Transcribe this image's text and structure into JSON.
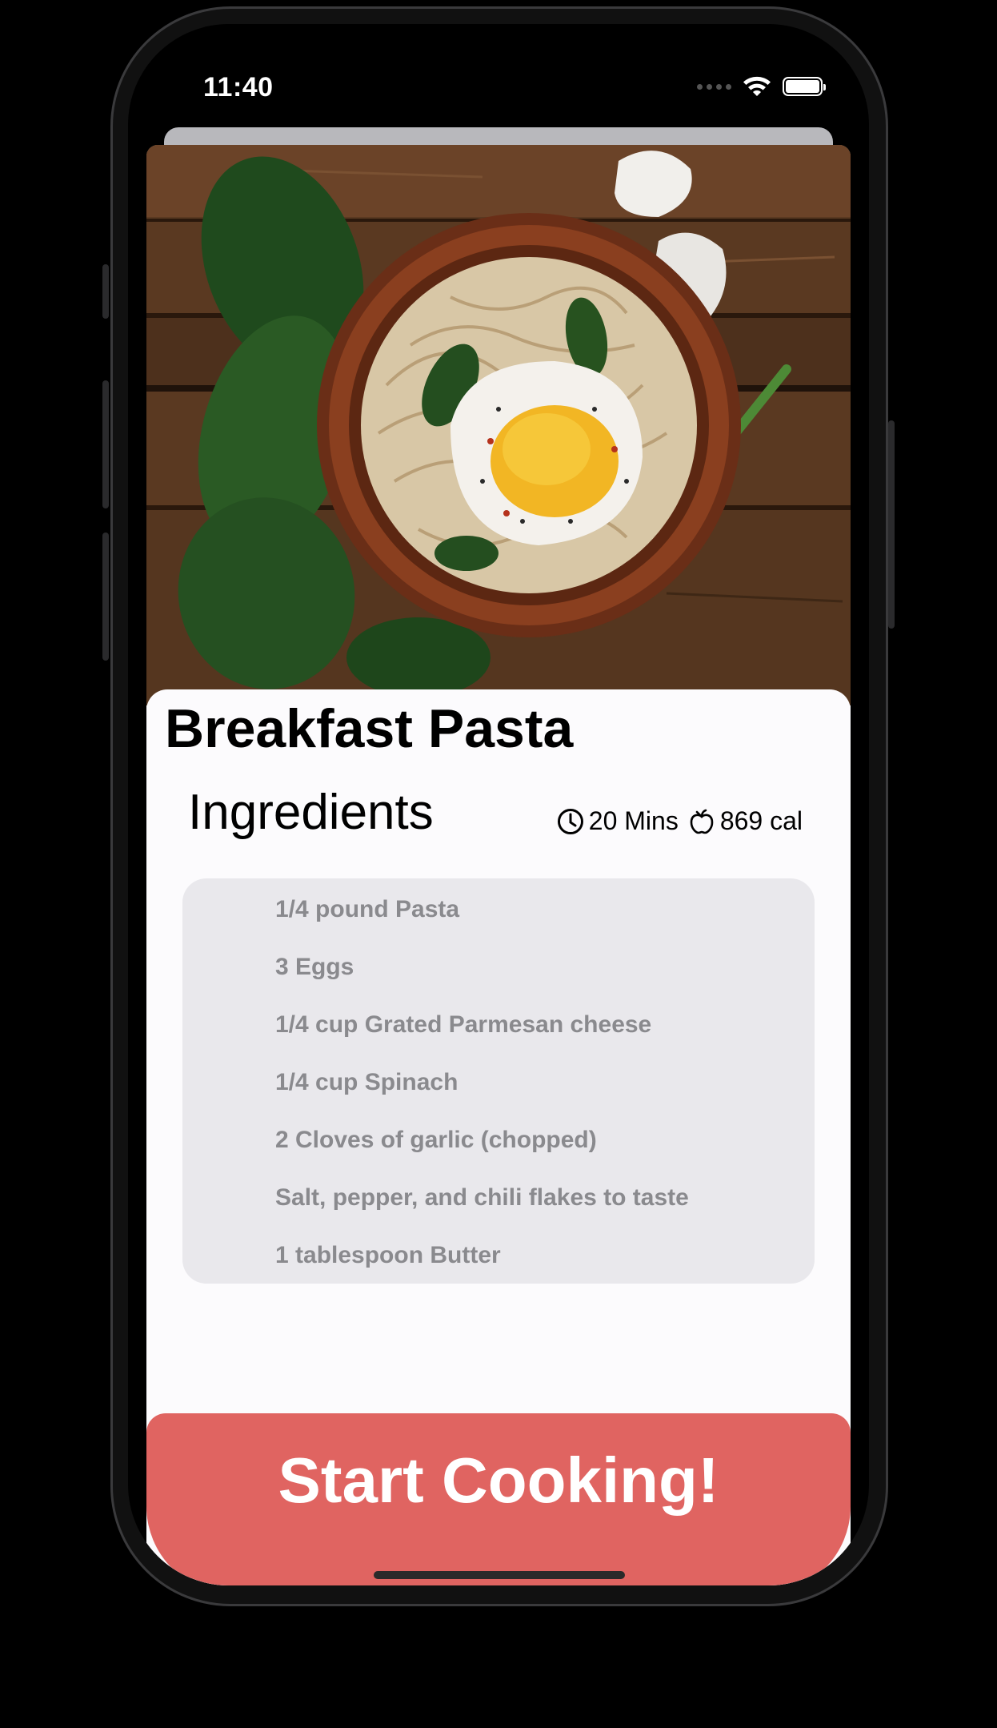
{
  "status_bar": {
    "time": "11:40"
  },
  "recipe": {
    "title": "Breakfast Pasta",
    "section_heading": "Ingredients",
    "duration": "20 Mins",
    "calories": "869 cal",
    "ingredients": [
      "1/4 pound Pasta",
      "3 Eggs",
      "1/4 cup Grated Parmesan cheese",
      "1/4 cup Spinach",
      "2 Cloves of garlic (chopped)",
      "Salt, pepper, and chili flakes to taste",
      "1 tablespoon Butter"
    ]
  },
  "cta": {
    "label": "Start Cooking!"
  },
  "colors": {
    "accent": "#e06461",
    "list_background": "#e9e8ec",
    "list_text": "#8a8a8e"
  },
  "icons": {
    "clock": "clock-icon",
    "calories": "apple-icon",
    "wifi": "wifi-icon",
    "battery": "battery-icon"
  }
}
